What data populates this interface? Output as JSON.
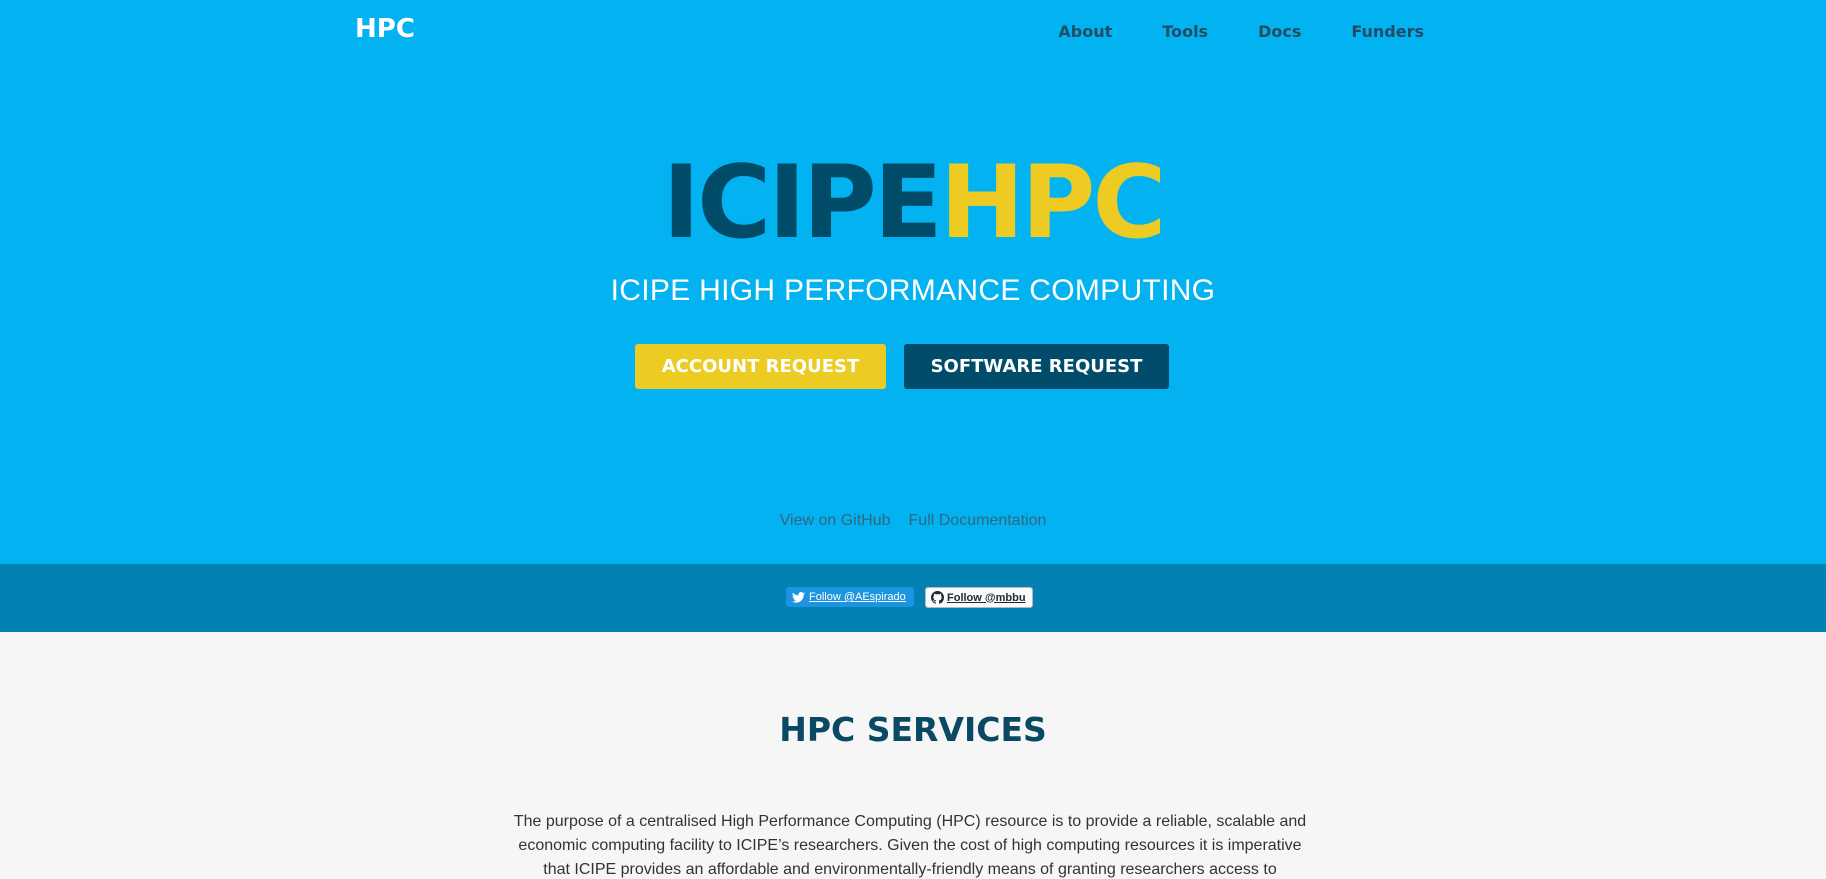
{
  "header": {
    "brand": "HPC",
    "nav": [
      {
        "label": "About"
      },
      {
        "label": "Tools"
      },
      {
        "label": "Docs"
      },
      {
        "label": "Funders"
      }
    ]
  },
  "hero": {
    "logo_part1": "ICIPE",
    "logo_part2": "HPC",
    "tagline": "ICIPE HIGH PERFORMANCE COMPUTING",
    "buttons": {
      "account": "ACCOUNT REQUEST",
      "software": "SOFTWARE REQUEST"
    },
    "links": {
      "github": "View on GitHub",
      "docs": "Full Documentation"
    }
  },
  "social": {
    "twitter": "Follow @AEspirado",
    "github": "Follow @mbbu"
  },
  "services": {
    "title": "HPC SERVICES",
    "description": "The purpose of a centralised High Performance Computing (HPC) resource is to provide a reliable, scalable and economic computing facility to ICIPE’s researchers. Given the cost of high computing resources it is imperative that ICIPE provides an affordable and environmentally-friendly means of granting researchers access to computing"
  },
  "colors": {
    "hero_bg": "#03b2f0",
    "dark_blue": "#004b68",
    "yellow": "#edcb23",
    "social_bar": "#0281b2",
    "page_bg": "#f6f6f6"
  }
}
